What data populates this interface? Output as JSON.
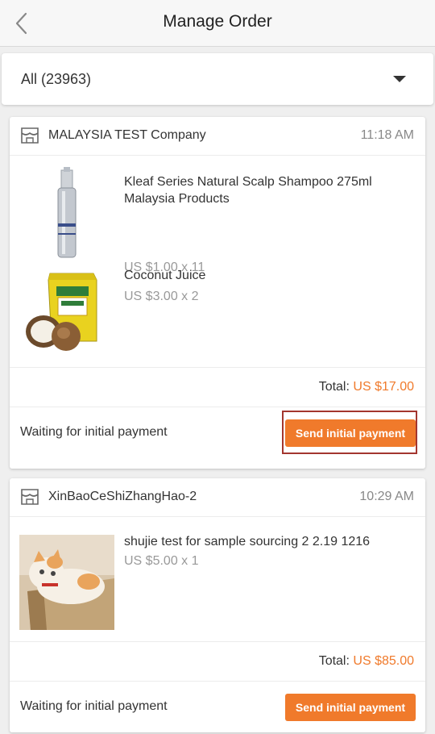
{
  "nav": {
    "title": "Manage Order"
  },
  "filter": {
    "selected": "All (23963)"
  },
  "orders": [
    {
      "shop": "MALAYSIA TEST Company",
      "time": "11:18 AM",
      "items": [
        {
          "name": "Kleaf Series Natural Scalp Shampoo 275ml Malaysia Products",
          "price": "US $1.00 x 11",
          "image": "shampoo-bottle"
        },
        {
          "name": "Coconut Juice",
          "price": "US $3.00 x 2",
          "image": "coconut-juice-box"
        }
      ],
      "total_label": "Total:",
      "total_value": "US $17.00",
      "status": "Waiting for initial payment",
      "action": "Send initial payment"
    },
    {
      "shop": "XinBaoCeShiZhangHao-2",
      "time": "10:29 AM",
      "items": [
        {
          "name": "shujie test for sample sourcing 2 2.19 1216",
          "price": "US $5.00 x 1",
          "image": "cat-photo"
        }
      ],
      "total_label": "Total:",
      "total_value": "US $85.00",
      "status": "Waiting for initial payment",
      "action": "Send initial payment"
    }
  ],
  "colors": {
    "accent": "#f07a2b",
    "highlight_border": "#a3362f"
  }
}
